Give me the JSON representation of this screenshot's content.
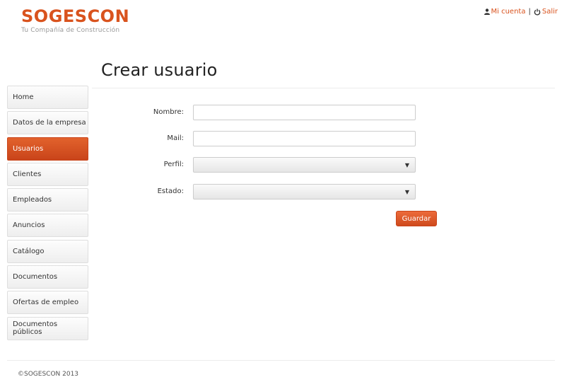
{
  "brand": {
    "name": "SOGESCON",
    "tagline": "Tu Compañía de Construcción"
  },
  "user_links": {
    "account": "Mi cuenta",
    "separator": "|",
    "logout": "Salir"
  },
  "page": {
    "title": "Crear usuario"
  },
  "sidebar": {
    "items": [
      {
        "label": "Home"
      },
      {
        "label": "Datos de la empresa"
      },
      {
        "label": "Usuarios",
        "active": true
      },
      {
        "label": "Clientes"
      },
      {
        "label": "Empleados"
      },
      {
        "label": "Anuncios"
      },
      {
        "label": "Catálogo"
      },
      {
        "label": "Documentos"
      },
      {
        "label": "Ofertas de empleo"
      },
      {
        "label": "Documentos públicos"
      }
    ]
  },
  "form": {
    "nombre": {
      "label": "Nombre:",
      "value": ""
    },
    "mail": {
      "label": "Mail:",
      "value": ""
    },
    "perfil": {
      "label": "Perfil:",
      "selected": ""
    },
    "estado": {
      "label": "Estado:",
      "selected": ""
    },
    "save_label": "Guardar"
  },
  "footer": {
    "text": "©SOGESCON 2013"
  },
  "colors": {
    "accent": "#d9531e",
    "active_nav": "#d65a24",
    "text": "#333333"
  },
  "icons": {
    "account": "user-icon",
    "logout": "power-icon",
    "dropdown": "caret-down-icon"
  }
}
